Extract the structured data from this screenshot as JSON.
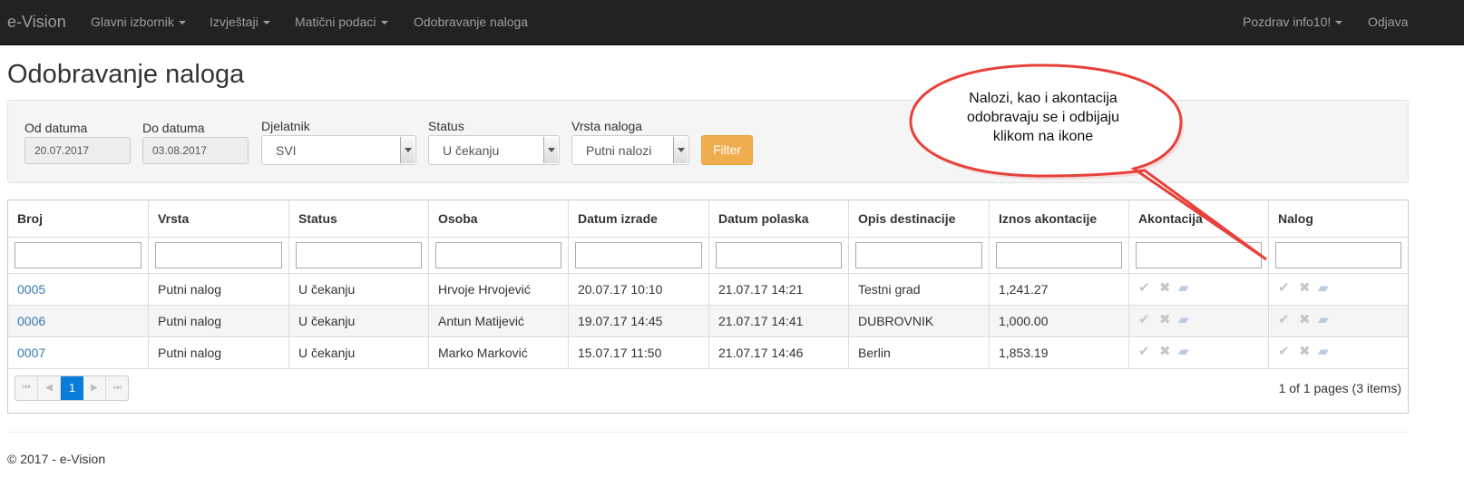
{
  "navbar": {
    "brand": "e-Vision",
    "items": [
      {
        "label": "Glavni izbornik",
        "dropdown": true
      },
      {
        "label": "Izvještaji",
        "dropdown": true
      },
      {
        "label": "Matični podaci",
        "dropdown": true
      },
      {
        "label": "Odobravanje naloga",
        "dropdown": false
      }
    ],
    "greeting": "Pozdrav info10!",
    "logout": "Odjava"
  },
  "page": {
    "title": "Odobravanje naloga"
  },
  "filters": {
    "from_label": "Od datuma",
    "from_value": "20.07.2017",
    "to_label": "Do datuma",
    "to_value": "03.08.2017",
    "employee_label": "Djelatnik",
    "employee_value": "SVI",
    "status_label": "Status",
    "status_value": "U čekanju",
    "type_label": "Vrsta naloga",
    "type_value": "Putni nalozi",
    "filter_button": "Filter"
  },
  "grid": {
    "columns": [
      "Broj",
      "Vrsta",
      "Status",
      "Osoba",
      "Datum izrade",
      "Datum polaska",
      "Opis destinacije",
      "Iznos akontacije",
      "Akontacija",
      "Nalog"
    ],
    "rows": [
      [
        "0005",
        "Putni nalog",
        "U čekanju",
        "Hrvoje Hrvojević",
        "20.07.17 10:10",
        "21.07.17 14:21",
        "Testni grad",
        "1,241.27"
      ],
      [
        "0006",
        "Putni nalog",
        "U čekanju",
        "Antun Matijević",
        "19.07.17 14:45",
        "21.07.17 14:41",
        "DUBROVNIK",
        "1,000.00"
      ],
      [
        "0007",
        "Putni nalog",
        "U čekanju",
        "Marko Marković",
        "15.07.17 11:50",
        "21.07.17 14:46",
        "Berlin",
        "1,853.19"
      ]
    ],
    "action_icons": [
      "check-icon",
      "x-icon",
      "comment-icon"
    ],
    "pager": {
      "current_page": "1",
      "info": "1 of 1 pages (3 items)"
    }
  },
  "callout": {
    "lines": [
      "Nalozi, kao i akontacija",
      "odobravaju se i odbijaju",
      "klikom na ikone"
    ]
  },
  "footer": {
    "text": "© 2017 - e-Vision"
  },
  "colors": {
    "navbar": "#222222",
    "link": "#337ab7",
    "filter_button": "#f0ad4e",
    "callout_border": "#e8403a",
    "active_page": "#0a7cd9"
  }
}
